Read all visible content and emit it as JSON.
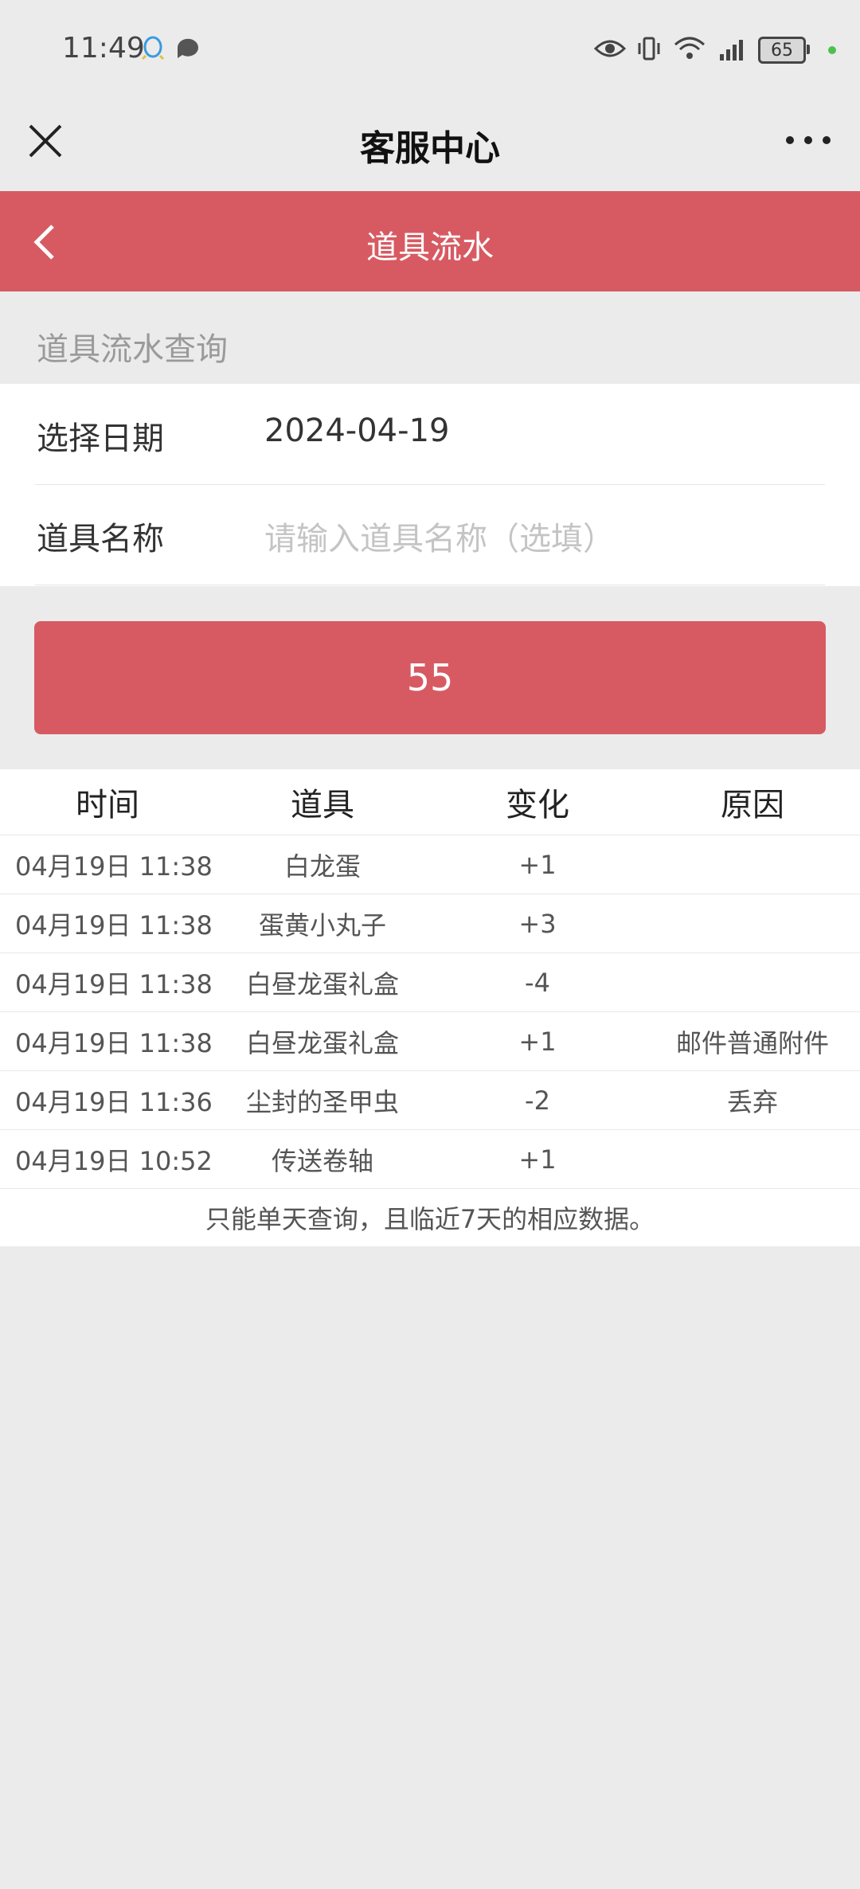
{
  "status_bar": {
    "time": "11:49",
    "battery": "65",
    "icons": [
      "qq-icon",
      "chat-icon",
      "eye-icon",
      "vibrate-icon",
      "wifi-icon",
      "signal-icon",
      "battery-icon"
    ]
  },
  "nav": {
    "title": "客服中心",
    "close_icon": "close-icon",
    "more_icon": "more-icon"
  },
  "header": {
    "title": "道具流水",
    "back_icon": "back-icon",
    "color": "#d75a62"
  },
  "section": {
    "label": "道具流水查询"
  },
  "form": {
    "date_label": "选择日期",
    "date_value": "2024-04-19",
    "item_label": "道具名称",
    "item_placeholder": "请输入道具名称（选填）"
  },
  "button": {
    "label": "55"
  },
  "table": {
    "headers": [
      "时间",
      "道具",
      "变化",
      "原因"
    ],
    "rows": [
      {
        "time": "04月19日 11:38",
        "item": "白龙蛋",
        "change": "+1",
        "reason": ""
      },
      {
        "time": "04月19日 11:38",
        "item": "蛋黄小丸子",
        "change": "+3",
        "reason": ""
      },
      {
        "time": "04月19日 11:38",
        "item": "白昼龙蛋礼盒",
        "change": "-4",
        "reason": ""
      },
      {
        "time": "04月19日 11:38",
        "item": "白昼龙蛋礼盒",
        "change": "+1",
        "reason": "邮件普通附件"
      },
      {
        "time": "04月19日 11:36",
        "item": "尘封的圣甲虫",
        "change": "-2",
        "reason": "丢弃"
      },
      {
        "time": "04月19日 10:52",
        "item": "传送卷轴",
        "change": "+1",
        "reason": ""
      }
    ],
    "footer": "只能单天查询，且临近7天的相应数据。"
  }
}
